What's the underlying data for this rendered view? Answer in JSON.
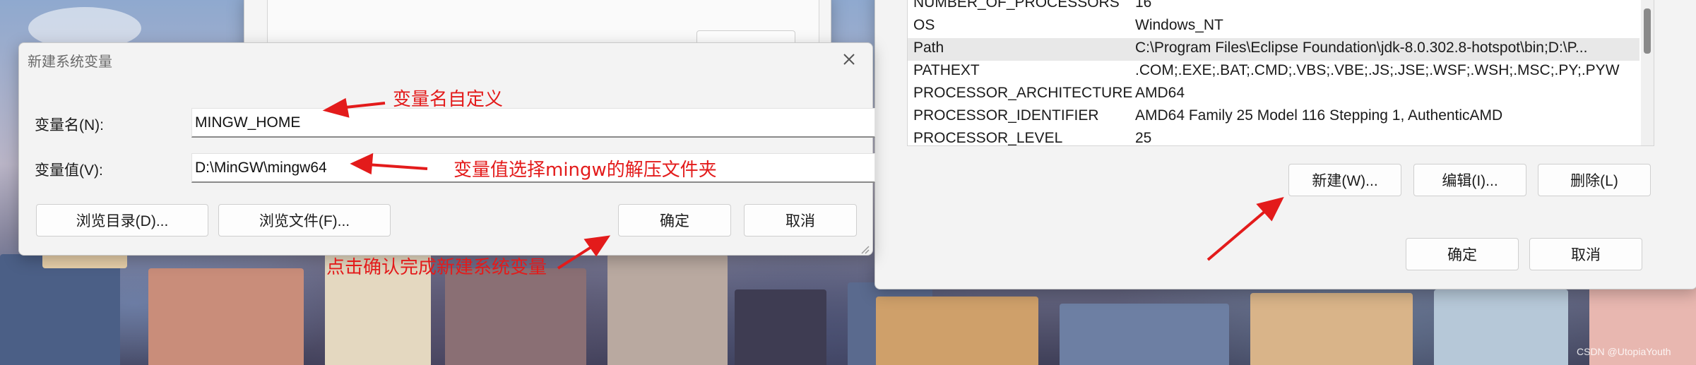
{
  "new_var_dialog": {
    "title": "新建系统变量",
    "name_label": "变量名(N):",
    "name_value": "MINGW_HOME",
    "value_label": "变量值(V):",
    "value_value": "D:\\MinGW\\mingw64",
    "browse_dir_label": "浏览目录(D)...",
    "browse_file_label": "浏览文件(F)...",
    "ok_label": "确定",
    "cancel_label": "取消"
  },
  "env_window": {
    "rows": [
      {
        "name": "NUMBER_OF_PROCESSORS",
        "value": "16"
      },
      {
        "name": "OS",
        "value": "Windows_NT"
      },
      {
        "name": "Path",
        "value": "C:\\Program Files\\Eclipse Foundation\\jdk-8.0.302.8-hotspot\\bin;D:\\P..."
      },
      {
        "name": "PATHEXT",
        "value": ".COM;.EXE;.BAT;.CMD;.VBS;.VBE;.JS;.JSE;.WSF;.WSH;.MSC;.PY;.PYW"
      },
      {
        "name": "PROCESSOR_ARCHITECTURE",
        "value": "AMD64"
      },
      {
        "name": "PROCESSOR_IDENTIFIER",
        "value": "AMD64 Family 25 Model 116 Stepping 1, AuthenticAMD"
      },
      {
        "name": "PROCESSOR_LEVEL",
        "value": "25"
      }
    ],
    "new_label": "新建(W)...",
    "edit_label": "编辑(I)...",
    "delete_label": "删除(L)",
    "ok_label": "确定",
    "cancel_label": "取消"
  },
  "annotations": {
    "name_note": "变量名自定义",
    "value_note": "变量值选择mingw的解压文件夹",
    "ok_note": "点击确认完成新建系统变量"
  },
  "watermark": "CSDN @UtopiaYouth",
  "colors": {
    "annotation": "#e31b1b",
    "selected_row": "#e8e8e8"
  }
}
